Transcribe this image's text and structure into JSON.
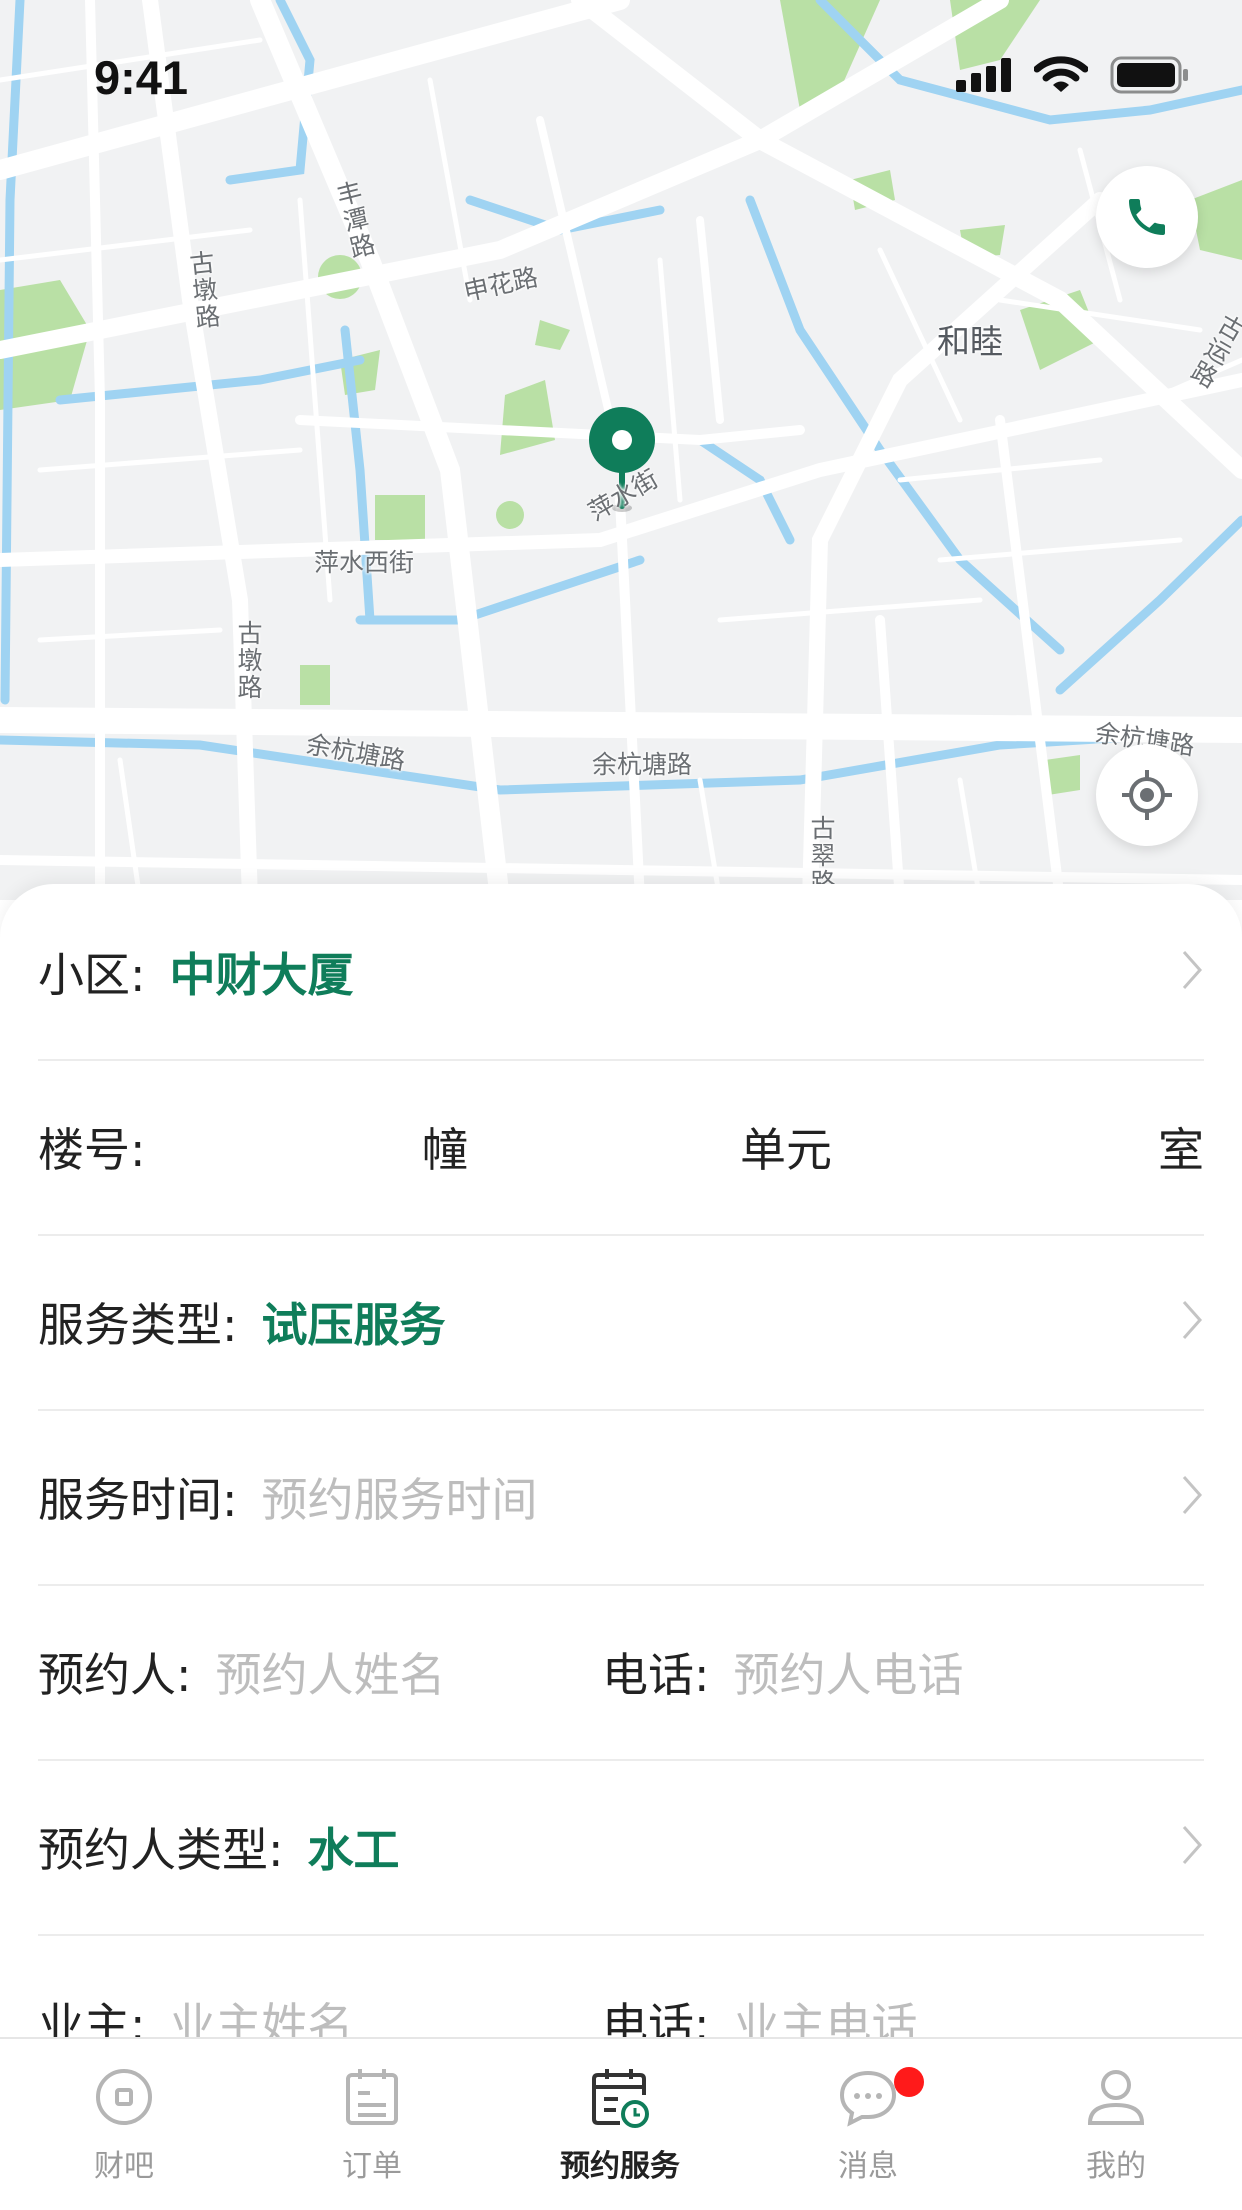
{
  "status_bar": {
    "time": "9:41"
  },
  "map": {
    "labels": {
      "fengtan_road": "丰潭路",
      "gudun_road_top": "古墩路",
      "shenhua_road": "申花路",
      "hemu": "和睦",
      "guyun_road": "古运路",
      "pingshui_street": "萍水街",
      "pingshui_west_street": "萍水西街",
      "gudun_road_mid": "古墩路",
      "yuhangtang_road_left": "余杭塘路",
      "yuhangtang_road_center": "余杭塘路",
      "yuhangtang_road_right": "余杭塘路",
      "gucui_road": "古翠路"
    },
    "accent_color": "#0f7d5a"
  },
  "form": {
    "community": {
      "label": "小区:",
      "value": "中财大厦"
    },
    "building": {
      "label": "楼号:",
      "unit_building": "幢",
      "unit_unit": "单元",
      "unit_room": "室"
    },
    "service_type": {
      "label": "服务类型:",
      "value": "试压服务"
    },
    "service_time": {
      "label": "服务时间:",
      "placeholder": "预约服务时间"
    },
    "booker": {
      "label": "预约人:",
      "placeholder": "预约人姓名",
      "phone_label": "电话:",
      "phone_placeholder": "预约人电话"
    },
    "booker_type": {
      "label": "预约人类型:",
      "value": "水工"
    },
    "owner": {
      "label": "业主:",
      "placeholder": "业主姓名",
      "phone_label": "电话:",
      "phone_placeholder": "业主电话"
    }
  },
  "tabbar": {
    "tabs": [
      {
        "label": "财吧",
        "icon": "coin-icon",
        "active": false
      },
      {
        "label": "订单",
        "icon": "order-icon",
        "active": false
      },
      {
        "label": "预约服务",
        "icon": "calendar-clock-icon",
        "active": true
      },
      {
        "label": "消息",
        "icon": "chat-icon",
        "active": false,
        "badge": true
      },
      {
        "label": "我的",
        "icon": "user-icon",
        "active": false
      }
    ]
  }
}
